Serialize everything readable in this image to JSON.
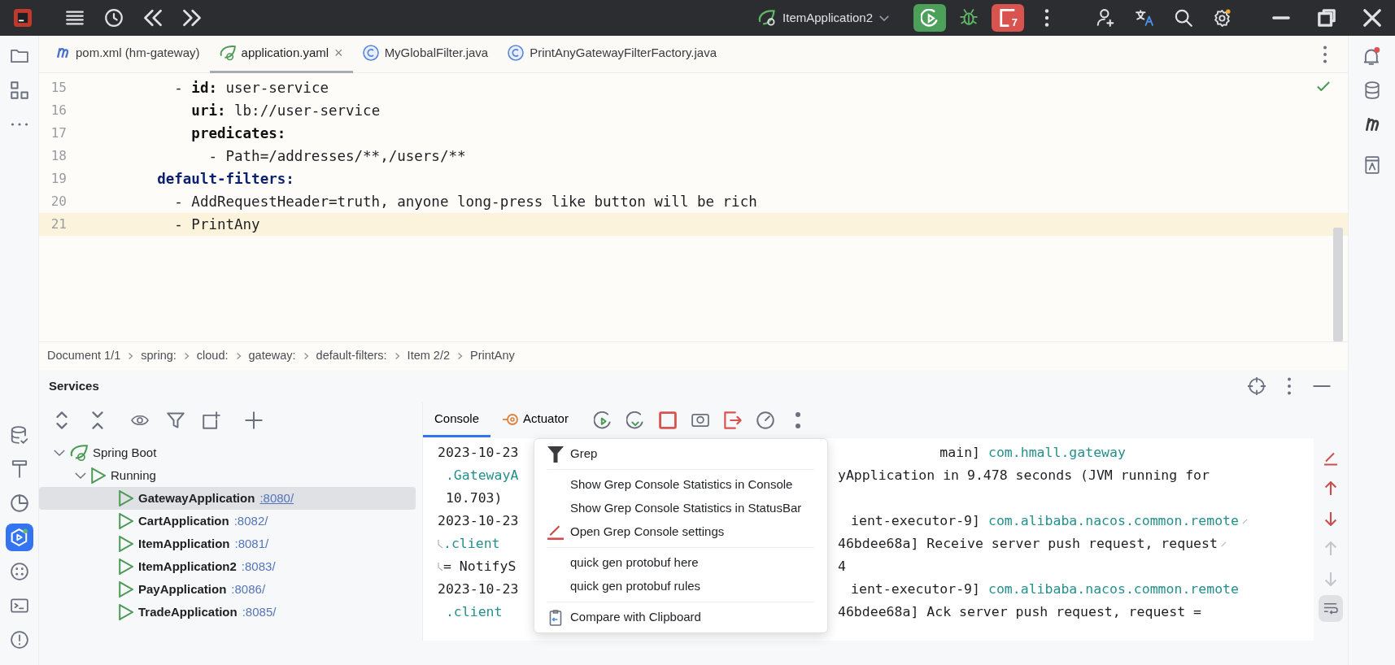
{
  "title_bar": {
    "run_config": "ItemApplication2",
    "stop_count": "7"
  },
  "tabs": [
    {
      "kind": "maven",
      "label": "pom.xml (hm-gateway)",
      "selected": false
    },
    {
      "kind": "spring",
      "label": "application.yaml",
      "selected": true,
      "close": "×"
    },
    {
      "kind": "class",
      "label": "MyGlobalFilter.java",
      "selected": false
    },
    {
      "kind": "class",
      "label": "PrintAnyGatewayFilterFactory.java",
      "selected": false
    }
  ],
  "left_toolbar_top": [
    {
      "kind": "folder",
      "selected": false
    },
    {
      "kind": "structure",
      "selected": false
    },
    {
      "kind": "more",
      "selected": false
    }
  ],
  "left_toolbar_bottom": [
    {
      "kind": "database",
      "selected": false
    },
    {
      "kind": "build",
      "selected": false
    },
    {
      "kind": "profiler",
      "selected": false
    },
    {
      "kind": "services",
      "selected": true
    },
    {
      "kind": "plugins",
      "selected": false
    },
    {
      "kind": "terminal",
      "selected": false
    },
    {
      "kind": "problems",
      "selected": false
    }
  ],
  "editor": {
    "lines": [
      {
        "number": "15",
        "current": false,
        "segments": [
          {
            "kind": "plain",
            "text": "        -"
          },
          {
            "kind": "key",
            "text": " id:"
          },
          {
            "kind": "plain",
            "text": " user-service"
          }
        ]
      },
      {
        "number": "16",
        "current": false,
        "segments": [
          {
            "kind": "key",
            "text": "          uri:"
          },
          {
            "kind": "plain",
            "text": " lb://user-service"
          }
        ]
      },
      {
        "number": "17",
        "current": false,
        "segments": [
          {
            "kind": "key",
            "text": "          predicates:"
          }
        ]
      },
      {
        "number": "18",
        "current": false,
        "segments": [
          {
            "kind": "plain",
            "text": "            - Path=/addresses/**,/users/**"
          }
        ]
      },
      {
        "number": "19",
        "current": false,
        "segments": [
          {
            "kind": "section",
            "text": "      default-filters:"
          }
        ]
      },
      {
        "number": "20",
        "current": false,
        "segments": [
          {
            "kind": "plain",
            "text": "        - AddRequestHeader=truth, anyone long-press like button will be rich"
          }
        ]
      },
      {
        "number": "21",
        "current": true,
        "segments": [
          {
            "kind": "plain",
            "text": "        - PrintAny"
          }
        ]
      }
    ]
  },
  "breadcrumbs": [
    "Document 1/1",
    "spring:",
    "cloud:",
    "gateway:",
    "default-filters:",
    "Item 2/2",
    "PrintAny"
  ],
  "services": {
    "title": "Services",
    "tree": [
      {
        "label": "Spring Boot",
        "kind": "spring",
        "expanded": true,
        "children": [
          {
            "label": "Running",
            "kind": "group",
            "expanded": true,
            "children": [
              {
                "label": "GatewayApplication",
                "kind": "app",
                "port": ":8080/",
                "selected": true
              },
              {
                "label": "CartApplication",
                "kind": "app",
                "port": ":8082/",
                "selected": false
              },
              {
                "label": "ItemApplication",
                "kind": "app",
                "port": ":8081/",
                "selected": false
              },
              {
                "label": "ItemApplication2",
                "kind": "app",
                "port": ":8083/",
                "selected": false
              },
              {
                "label": "PayApplication",
                "kind": "app",
                "port": ":8086/",
                "selected": false
              },
              {
                "label": "TradeApplication",
                "kind": "app",
                "port": ":8085/",
                "selected": false
              }
            ]
          }
        ]
      }
    ],
    "console_tabs": [
      {
        "label": "Console",
        "kind": "console",
        "selected": true
      },
      {
        "label": "Actuator",
        "kind": "actuator",
        "selected": false
      }
    ],
    "console_lines": [
      {
        "left": [
          {
            "kind": "plain",
            "text": "2023-10-23"
          }
        ],
        "right": [
          {
            "kind": "thread",
            "text": "main]"
          },
          {
            "kind": "logger",
            "text": "com.hmall.gateway"
          }
        ]
      },
      {
        "left": [
          {
            "kind": "logger",
            "text": " .GatewayA"
          }
        ],
        "right": [
          {
            "kind": "plain",
            "text": "yApplication in 9.478 seconds (JVM running for"
          }
        ]
      },
      {
        "left": [
          {
            "kind": "plain",
            "text": " 10.703)"
          }
        ]
      },
      {
        "left": [
          {
            "kind": "plain",
            "text": "2023-10-23"
          }
        ],
        "right": [
          {
            "kind": "thread",
            "text": "ient-executor-9]"
          },
          {
            "kind": "logger",
            "text": "com.alibaba.nacos.common.remote"
          }
        ],
        "wrap_end": true
      },
      {
        "wrap_start": true,
        "left": [
          {
            "kind": "logger",
            "text": ".client"
          }
        ],
        "right": [
          {
            "kind": "plain",
            "text": "46bdee68a] Receive server push request, request"
          }
        ],
        "wrap_end": true
      },
      {
        "wrap_start": true,
        "left": [
          {
            "kind": "plain",
            "text": "= NotifyS"
          }
        ],
        "right": [
          {
            "kind": "plain",
            "text": "4"
          }
        ]
      },
      {
        "left": [
          {
            "kind": "plain",
            "text": "2023-10-23"
          }
        ],
        "right": [
          {
            "kind": "thread",
            "text": "ient-executor-9]"
          },
          {
            "kind": "logger",
            "text": "com.alibaba.nacos.common.remote"
          }
        ]
      },
      {
        "left": [
          {
            "kind": "logger",
            "text": " .client"
          }
        ],
        "right": [
          {
            "kind": "plain",
            "text": "46bdee68a] Ack server push request, request ="
          }
        ]
      }
    ],
    "console_side_tools": [
      {
        "kind": "grep",
        "enabled": true
      },
      {
        "kind": "up",
        "enabled": true
      },
      {
        "kind": "down",
        "enabled": true
      },
      {
        "kind": "up",
        "enabled": false
      },
      {
        "kind": "down",
        "enabled": false
      },
      {
        "kind": "wrap",
        "enabled": true,
        "selected": true
      }
    ]
  },
  "context_menu": [
    {
      "kind": "grep",
      "label": "Grep"
    },
    {
      "kind": "separator"
    },
    {
      "kind": "item",
      "label": "Show Grep Console Statistics in Console"
    },
    {
      "kind": "item",
      "label": "Show Grep Console Statistics in StatusBar"
    },
    {
      "kind": "settings",
      "label": "Open Grep Console settings"
    },
    {
      "kind": "separator"
    },
    {
      "kind": "item",
      "label": "quick gen protobuf here"
    },
    {
      "kind": "item",
      "label": "quick gen protobuf rules"
    },
    {
      "kind": "separator"
    },
    {
      "kind": "compare",
      "label": "Compare with Clipboard"
    }
  ]
}
